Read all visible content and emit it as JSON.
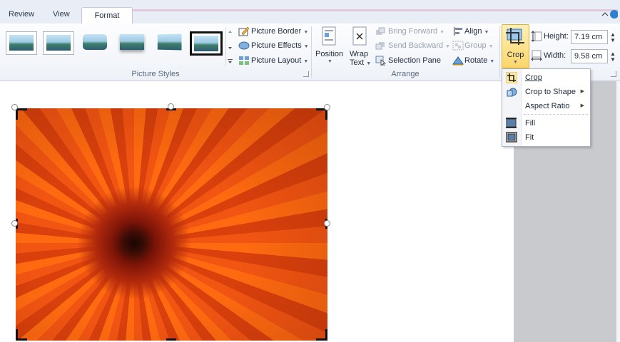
{
  "tabs": [
    {
      "label": "Review"
    },
    {
      "label": "View"
    },
    {
      "label": "Format"
    }
  ],
  "ribbon": {
    "picture_styles": {
      "group_label": "Picture Styles",
      "picture_border": "Picture Border",
      "picture_effects": "Picture Effects",
      "picture_layout": "Picture Layout"
    },
    "arrange": {
      "group_label": "Arrange",
      "position": "Position",
      "wrap_line1": "Wrap",
      "wrap_line2": "Text",
      "bring_forward": "Bring Forward",
      "send_backward": "Send Backward",
      "selection_pane": "Selection Pane",
      "align": "Align",
      "group": "Group",
      "rotate": "Rotate"
    },
    "size": {
      "crop": "Crop",
      "height_label": "Height:",
      "height_value": "7.19 cm",
      "width_label": "Width:",
      "width_value": "9.58 cm"
    }
  },
  "crop_menu": {
    "items": [
      {
        "label": "Crop"
      },
      {
        "label": "Crop to Shape"
      },
      {
        "label": "Aspect Ratio"
      },
      {
        "label": "Fill"
      },
      {
        "label": "Fit"
      }
    ]
  },
  "icons": [
    "help-icon",
    "picture-border-icon",
    "picture-effects-icon",
    "picture-layout-icon",
    "position-icon",
    "wrap-text-icon",
    "bring-forward-icon",
    "send-backward-icon",
    "selection-pane-icon",
    "align-icon",
    "group-icon",
    "rotate-icon",
    "crop-icon",
    "height-icon",
    "width-icon"
  ],
  "colors": {
    "accent_tab": "#e3c7da",
    "crop_button": "#fbe28c",
    "photo": "#e84a10"
  }
}
